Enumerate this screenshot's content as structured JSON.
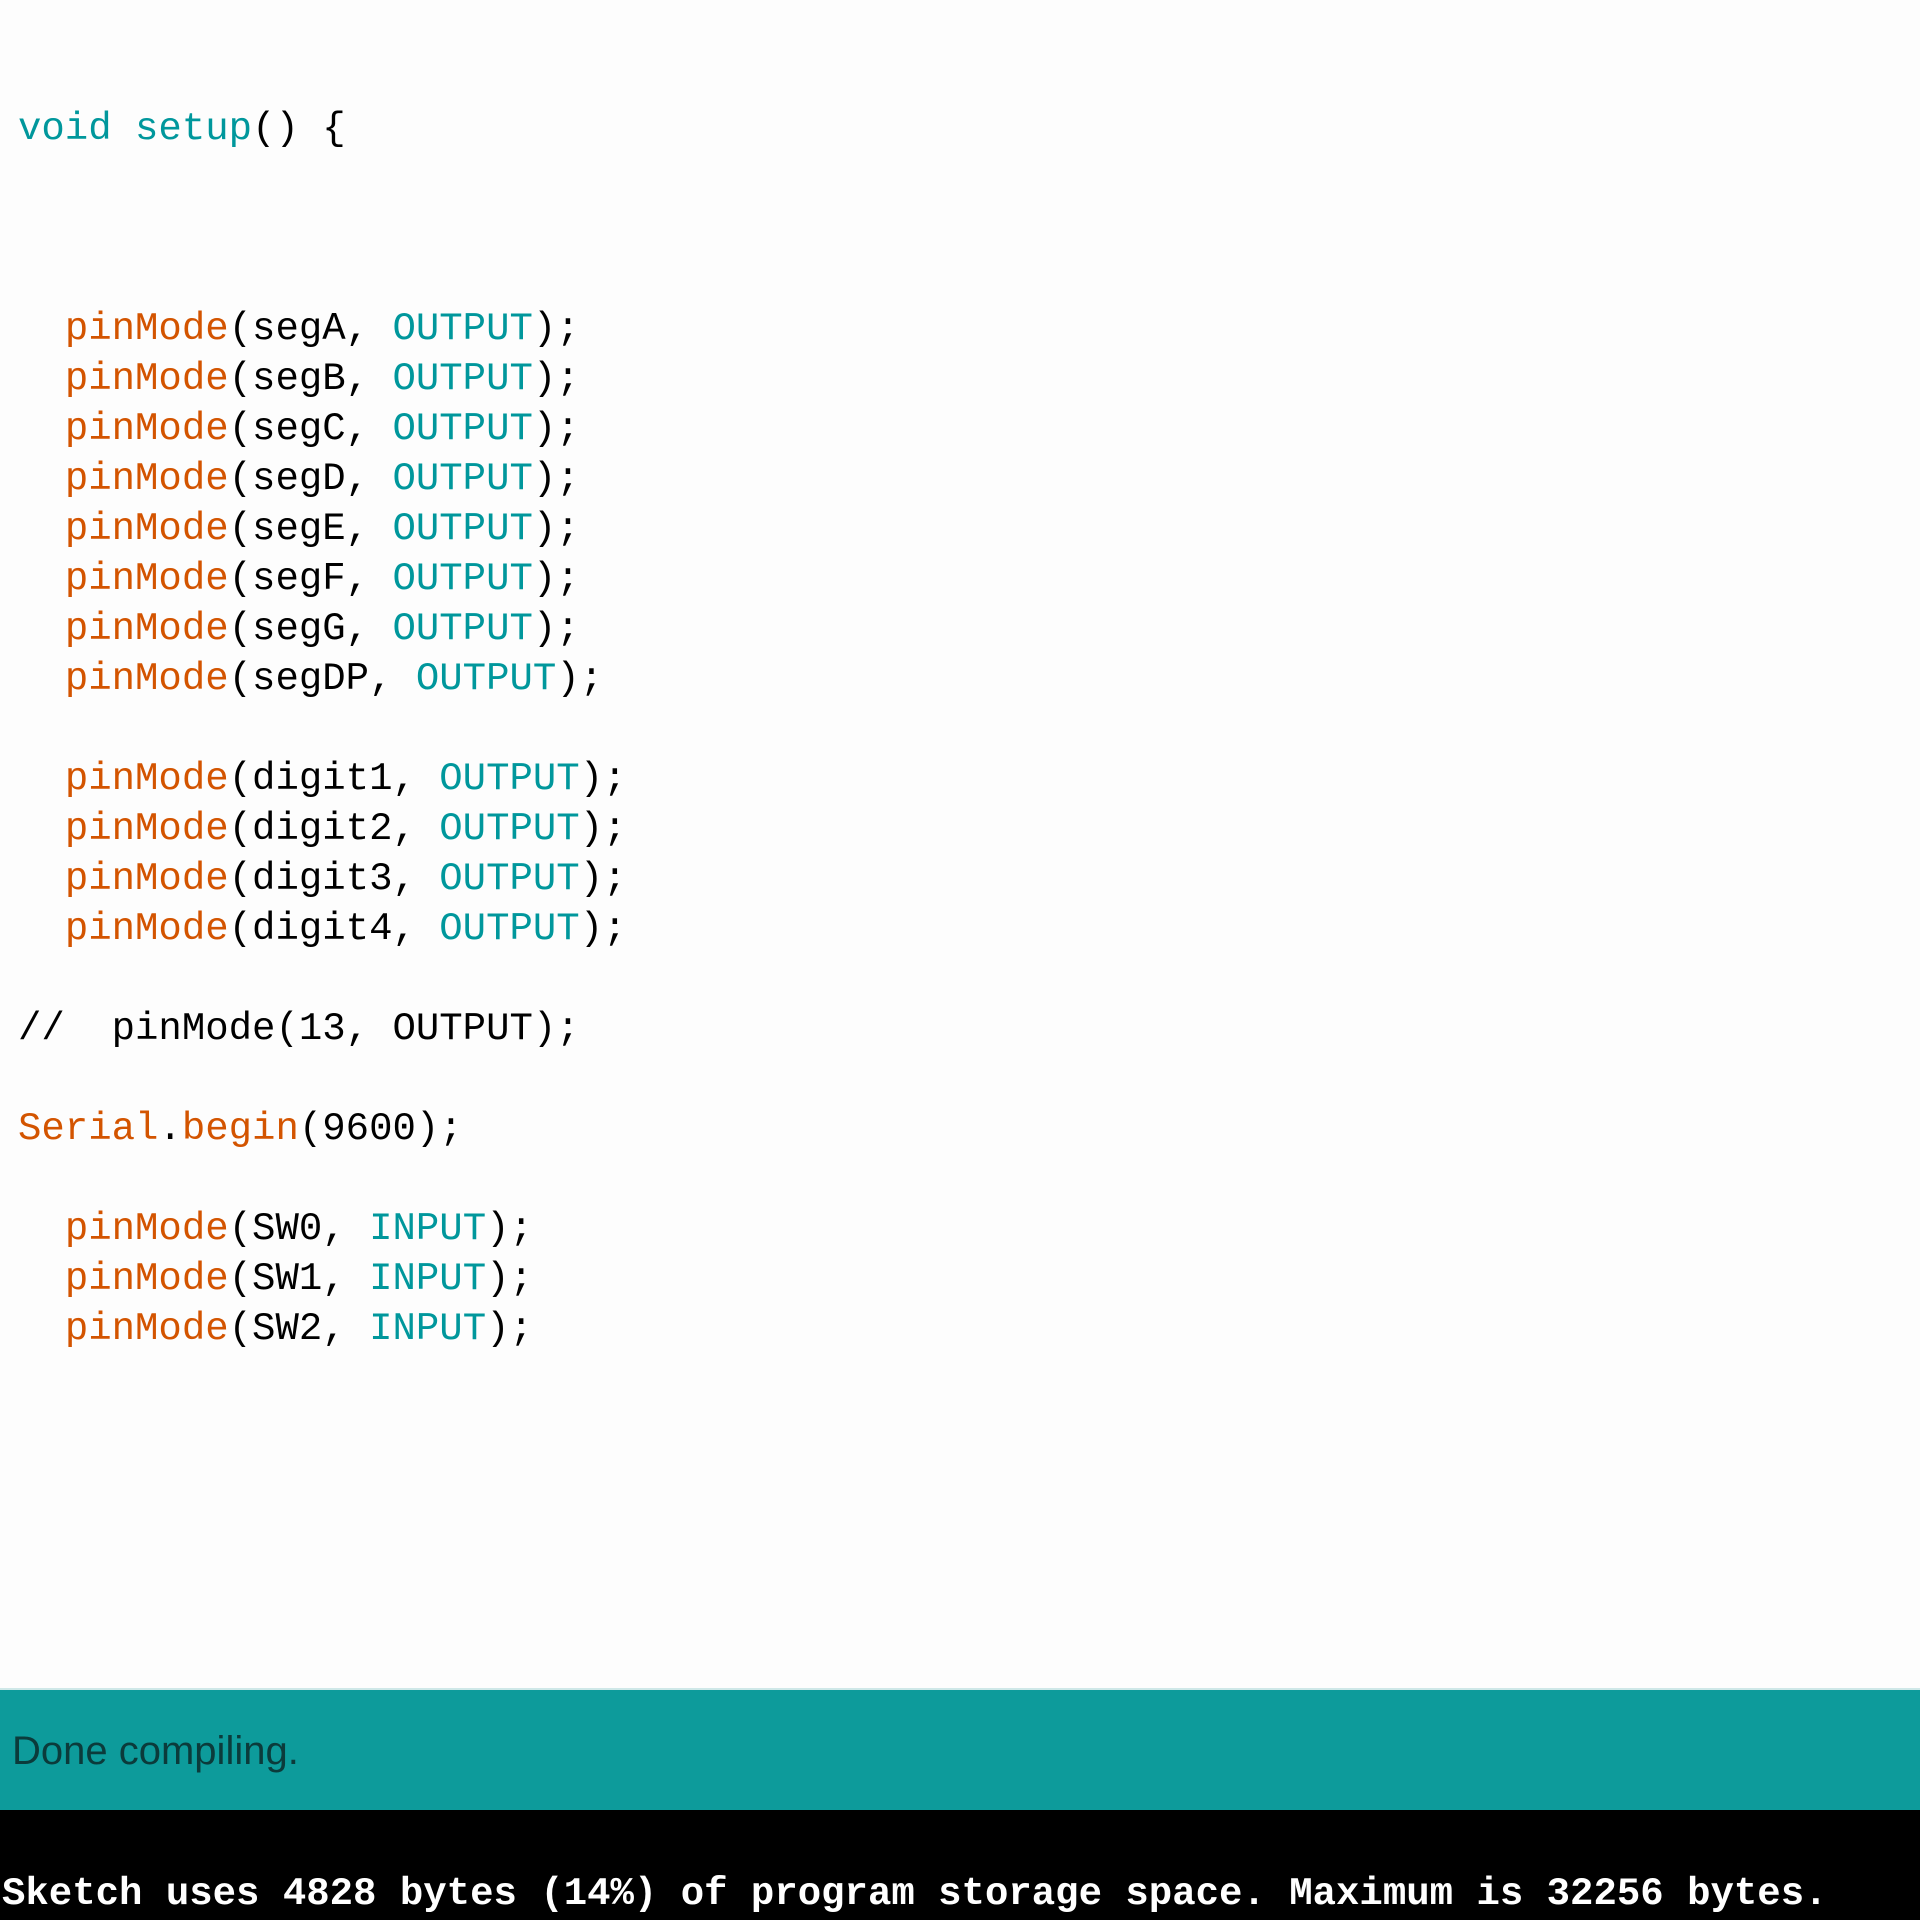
{
  "editor": {
    "lines": [
      {
        "tokens": [
          {
            "text": "void",
            "role": "kw"
          },
          {
            "text": " ",
            "role": "pl"
          },
          {
            "text": "setup",
            "role": "kw"
          },
          {
            "text": "() {",
            "role": "pl"
          }
        ]
      },
      {
        "tokens": [
          {
            "text": "  ",
            "role": "pl"
          },
          {
            "text": "pinMode",
            "role": "fn"
          },
          {
            "text": "(segA, ",
            "role": "pl"
          },
          {
            "text": "OUTPUT",
            "role": "kw"
          },
          {
            "text": ");",
            "role": "pl"
          }
        ]
      },
      {
        "tokens": [
          {
            "text": "  ",
            "role": "pl"
          },
          {
            "text": "pinMode",
            "role": "fn"
          },
          {
            "text": "(segB, ",
            "role": "pl"
          },
          {
            "text": "OUTPUT",
            "role": "kw"
          },
          {
            "text": ");",
            "role": "pl"
          }
        ]
      },
      {
        "tokens": [
          {
            "text": "  ",
            "role": "pl"
          },
          {
            "text": "pinMode",
            "role": "fn"
          },
          {
            "text": "(segC, ",
            "role": "pl"
          },
          {
            "text": "OUTPUT",
            "role": "kw"
          },
          {
            "text": ");",
            "role": "pl"
          }
        ]
      },
      {
        "tokens": [
          {
            "text": "  ",
            "role": "pl"
          },
          {
            "text": "pinMode",
            "role": "fn"
          },
          {
            "text": "(segD, ",
            "role": "pl"
          },
          {
            "text": "OUTPUT",
            "role": "kw"
          },
          {
            "text": ");",
            "role": "pl"
          }
        ]
      },
      {
        "tokens": [
          {
            "text": "  ",
            "role": "pl"
          },
          {
            "text": "pinMode",
            "role": "fn"
          },
          {
            "text": "(segE, ",
            "role": "pl"
          },
          {
            "text": "OUTPUT",
            "role": "kw"
          },
          {
            "text": ");",
            "role": "pl"
          }
        ]
      },
      {
        "tokens": [
          {
            "text": "  ",
            "role": "pl"
          },
          {
            "text": "pinMode",
            "role": "fn"
          },
          {
            "text": "(segF, ",
            "role": "pl"
          },
          {
            "text": "OUTPUT",
            "role": "kw"
          },
          {
            "text": ");",
            "role": "pl"
          }
        ]
      },
      {
        "tokens": [
          {
            "text": "  ",
            "role": "pl"
          },
          {
            "text": "pinMode",
            "role": "fn"
          },
          {
            "text": "(segG, ",
            "role": "pl"
          },
          {
            "text": "OUTPUT",
            "role": "kw"
          },
          {
            "text": ");",
            "role": "pl"
          }
        ]
      },
      {
        "tokens": [
          {
            "text": "  ",
            "role": "pl"
          },
          {
            "text": "pinMode",
            "role": "fn"
          },
          {
            "text": "(segDP, ",
            "role": "pl"
          },
          {
            "text": "OUTPUT",
            "role": "kw"
          },
          {
            "text": ");",
            "role": "pl"
          }
        ]
      },
      {
        "tokens": [
          {
            "text": "  ",
            "role": "pl"
          },
          {
            "text": "pinMode",
            "role": "fn"
          },
          {
            "text": "(digit1, ",
            "role": "pl"
          },
          {
            "text": "OUTPUT",
            "role": "kw"
          },
          {
            "text": ");",
            "role": "pl"
          }
        ]
      },
      {
        "tokens": [
          {
            "text": "  ",
            "role": "pl"
          },
          {
            "text": "pinMode",
            "role": "fn"
          },
          {
            "text": "(digit2, ",
            "role": "pl"
          },
          {
            "text": "OUTPUT",
            "role": "kw"
          },
          {
            "text": ");",
            "role": "pl"
          }
        ]
      },
      {
        "tokens": [
          {
            "text": "  ",
            "role": "pl"
          },
          {
            "text": "pinMode",
            "role": "fn"
          },
          {
            "text": "(digit3, ",
            "role": "pl"
          },
          {
            "text": "OUTPUT",
            "role": "kw"
          },
          {
            "text": ");",
            "role": "pl"
          }
        ]
      },
      {
        "tokens": [
          {
            "text": "  ",
            "role": "pl"
          },
          {
            "text": "pinMode",
            "role": "fn"
          },
          {
            "text": "(digit4, ",
            "role": "pl"
          },
          {
            "text": "OUTPUT",
            "role": "kw"
          },
          {
            "text": ");",
            "role": "pl"
          }
        ]
      },
      {
        "tokens": [
          {
            "text": "//  pinMode(13, OUTPUT);",
            "role": "cm"
          }
        ]
      },
      {
        "tokens": [
          {
            "text": "Serial",
            "role": "fn"
          },
          {
            "text": ".",
            "role": "pl"
          },
          {
            "text": "begin",
            "role": "fn"
          },
          {
            "text": "(9600);",
            "role": "pl"
          }
        ]
      },
      {
        "tokens": [
          {
            "text": "  ",
            "role": "pl"
          },
          {
            "text": "pinMode",
            "role": "fn"
          },
          {
            "text": "(SW0, ",
            "role": "pl"
          },
          {
            "text": "INPUT",
            "role": "kw"
          },
          {
            "text": ");",
            "role": "pl"
          }
        ]
      },
      {
        "tokens": [
          {
            "text": "  ",
            "role": "pl"
          },
          {
            "text": "pinMode",
            "role": "fn"
          },
          {
            "text": "(SW1, ",
            "role": "pl"
          },
          {
            "text": "INPUT",
            "role": "kw"
          },
          {
            "text": ");",
            "role": "pl"
          }
        ]
      },
      {
        "tokens": [
          {
            "text": "  ",
            "role": "pl"
          },
          {
            "text": "pinMode",
            "role": "fn"
          },
          {
            "text": "(SW2, ",
            "role": "pl"
          },
          {
            "text": "INPUT",
            "role": "kw"
          },
          {
            "text": ");",
            "role": "pl"
          }
        ]
      }
    ]
  },
  "status": {
    "message": "Done compiling."
  },
  "console": {
    "message": "Sketch uses 4828 bytes (14%) of program storage space. Maximum is 32256 bytes."
  },
  "colors": {
    "keyword": "#00979c",
    "function": "#d35400",
    "status_bar": "#0d9b9b",
    "console_bg": "#000000"
  }
}
